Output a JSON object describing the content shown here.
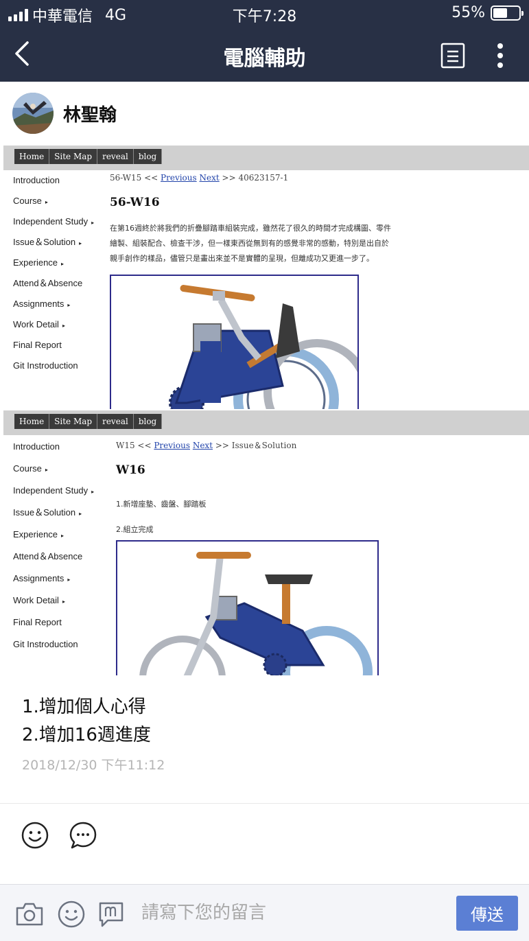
{
  "status_bar": {
    "carrier": "中華電信",
    "network": "4G",
    "time": "下午7:28",
    "battery_text": "55%",
    "battery_level": 0.55
  },
  "header": {
    "title": "電腦輔助",
    "back_icon": "chevron-left-icon",
    "notes_icon": "notes-icon",
    "more_icon": "more-vertical-icon"
  },
  "post": {
    "author": "林聖翰",
    "timestamp": "2018/12/30 下午11:12",
    "message_lines": [
      "1.增加個人心得",
      "2.增加16週進度"
    ]
  },
  "screenshot_1": {
    "nav_buttons": [
      "Home",
      "Site Map",
      "reveal",
      "blog"
    ],
    "sidebar": [
      {
        "label": "Introduction",
        "arrow": ""
      },
      {
        "label": "Course",
        "arrow": "▸"
      },
      {
        "label": "Independent Study",
        "arrow": "▸"
      },
      {
        "label": "Issue＆Solution",
        "arrow": "▸"
      },
      {
        "label": "Experience",
        "arrow": "▸"
      },
      {
        "label": "Attend＆Absence",
        "arrow": ""
      },
      {
        "label": "Assignments",
        "arrow": "▸"
      },
      {
        "label": "Work Detail",
        "arrow": "▸"
      },
      {
        "label": "Final Report",
        "arrow": ""
      },
      {
        "label": "Git Instroduction",
        "arrow": ""
      }
    ],
    "crumb_prefix": "56-W15 <<",
    "crumb_previous": "Previous",
    "crumb_next": "Next",
    "crumb_suffix": ">> 40623157-1",
    "heading": "56-W16",
    "paragraph_lines": [
      "在第16週終於將我們的折疊腳踏車組裝完成，雖然花了很久的時間才完成構圖、零件",
      "繪製、組裝配合、檢查干涉，但一樣東西從無到有的感覺非常的感動，特別是出自於",
      "親手創作的樣品，儘管只是畫出來並不是實體的呈現，但離成功又更進一步了。"
    ]
  },
  "screenshot_2": {
    "nav_buttons": [
      "Home",
      "Site Map",
      "reveal",
      "blog"
    ],
    "sidebar": [
      {
        "label": "Introduction",
        "arrow": ""
      },
      {
        "label": "Course",
        "arrow": "▸"
      },
      {
        "label": "Independent Study",
        "arrow": "▸"
      },
      {
        "label": "Issue＆Solution",
        "arrow": "▸"
      },
      {
        "label": "Experience",
        "arrow": "▸"
      },
      {
        "label": "Attend＆Absence",
        "arrow": ""
      },
      {
        "label": "Assignments",
        "arrow": "▸"
      },
      {
        "label": "Work Detail",
        "arrow": "▸"
      },
      {
        "label": "Final Report",
        "arrow": ""
      },
      {
        "label": "Git Instroduction",
        "arrow": ""
      }
    ],
    "crumb_prefix": "W15 <<",
    "crumb_previous": "Previous",
    "crumb_next": "Next",
    "crumb_suffix": ">> Issue＆Solution",
    "heading": "W16",
    "paragraph_lines": [
      "1.新增座墊、齒盤、腳踏板",
      "2.組立完成"
    ]
  },
  "reactions": {
    "like_icon": "smiley-icon",
    "comment_icon": "speech-bubble-icon"
  },
  "composer": {
    "placeholder": "請寫下您的留言",
    "send_label": "傳送",
    "camera_icon": "camera-icon",
    "emoji_icon": "smiley-icon",
    "mention_icon": "mention-icon"
  },
  "colors": {
    "header_bg": "#283045",
    "send_button": "#5b7fd4",
    "timestamp": "#b5b5b5",
    "figure_border": "#2d2a8a"
  }
}
